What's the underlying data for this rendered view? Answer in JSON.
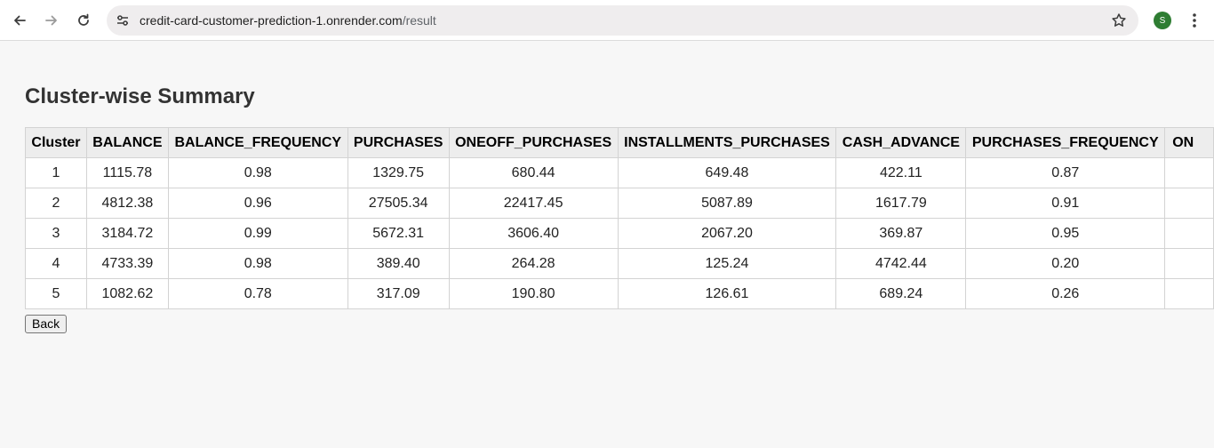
{
  "browser": {
    "url_host": "credit-card-customer-prediction-1.onrender.com",
    "url_path": "/result",
    "avatar_letter": "S",
    "icons": {
      "back": "back-arrow-icon",
      "forward": "forward-arrow-icon",
      "reload": "reload-icon",
      "site_info": "tune-icon",
      "bookmark": "star-icon",
      "menu": "kebab-menu-icon"
    },
    "colors": {
      "avatar": "#2e7d32"
    }
  },
  "page": {
    "title": "Cluster-wise Summary",
    "back_label": "Back"
  },
  "table": {
    "headers": [
      "Cluster",
      "BALANCE",
      "BALANCE_FREQUENCY",
      "PURCHASES",
      "ONEOFF_PURCHASES",
      "INSTALLMENTS_PURCHASES",
      "CASH_ADVANCE",
      "PURCHASES_FREQUENCY",
      "ON"
    ],
    "rows": [
      [
        "1",
        "1115.78",
        "0.98",
        "1329.75",
        "680.44",
        "649.48",
        "422.11",
        "0.87",
        ""
      ],
      [
        "2",
        "4812.38",
        "0.96",
        "27505.34",
        "22417.45",
        "5087.89",
        "1617.79",
        "0.91",
        ""
      ],
      [
        "3",
        "3184.72",
        "0.99",
        "5672.31",
        "3606.40",
        "2067.20",
        "369.87",
        "0.95",
        ""
      ],
      [
        "4",
        "4733.39",
        "0.98",
        "389.40",
        "264.28",
        "125.24",
        "4742.44",
        "0.20",
        ""
      ],
      [
        "5",
        "1082.62",
        "0.78",
        "317.09",
        "190.80",
        "126.61",
        "689.24",
        "0.26",
        ""
      ]
    ]
  }
}
